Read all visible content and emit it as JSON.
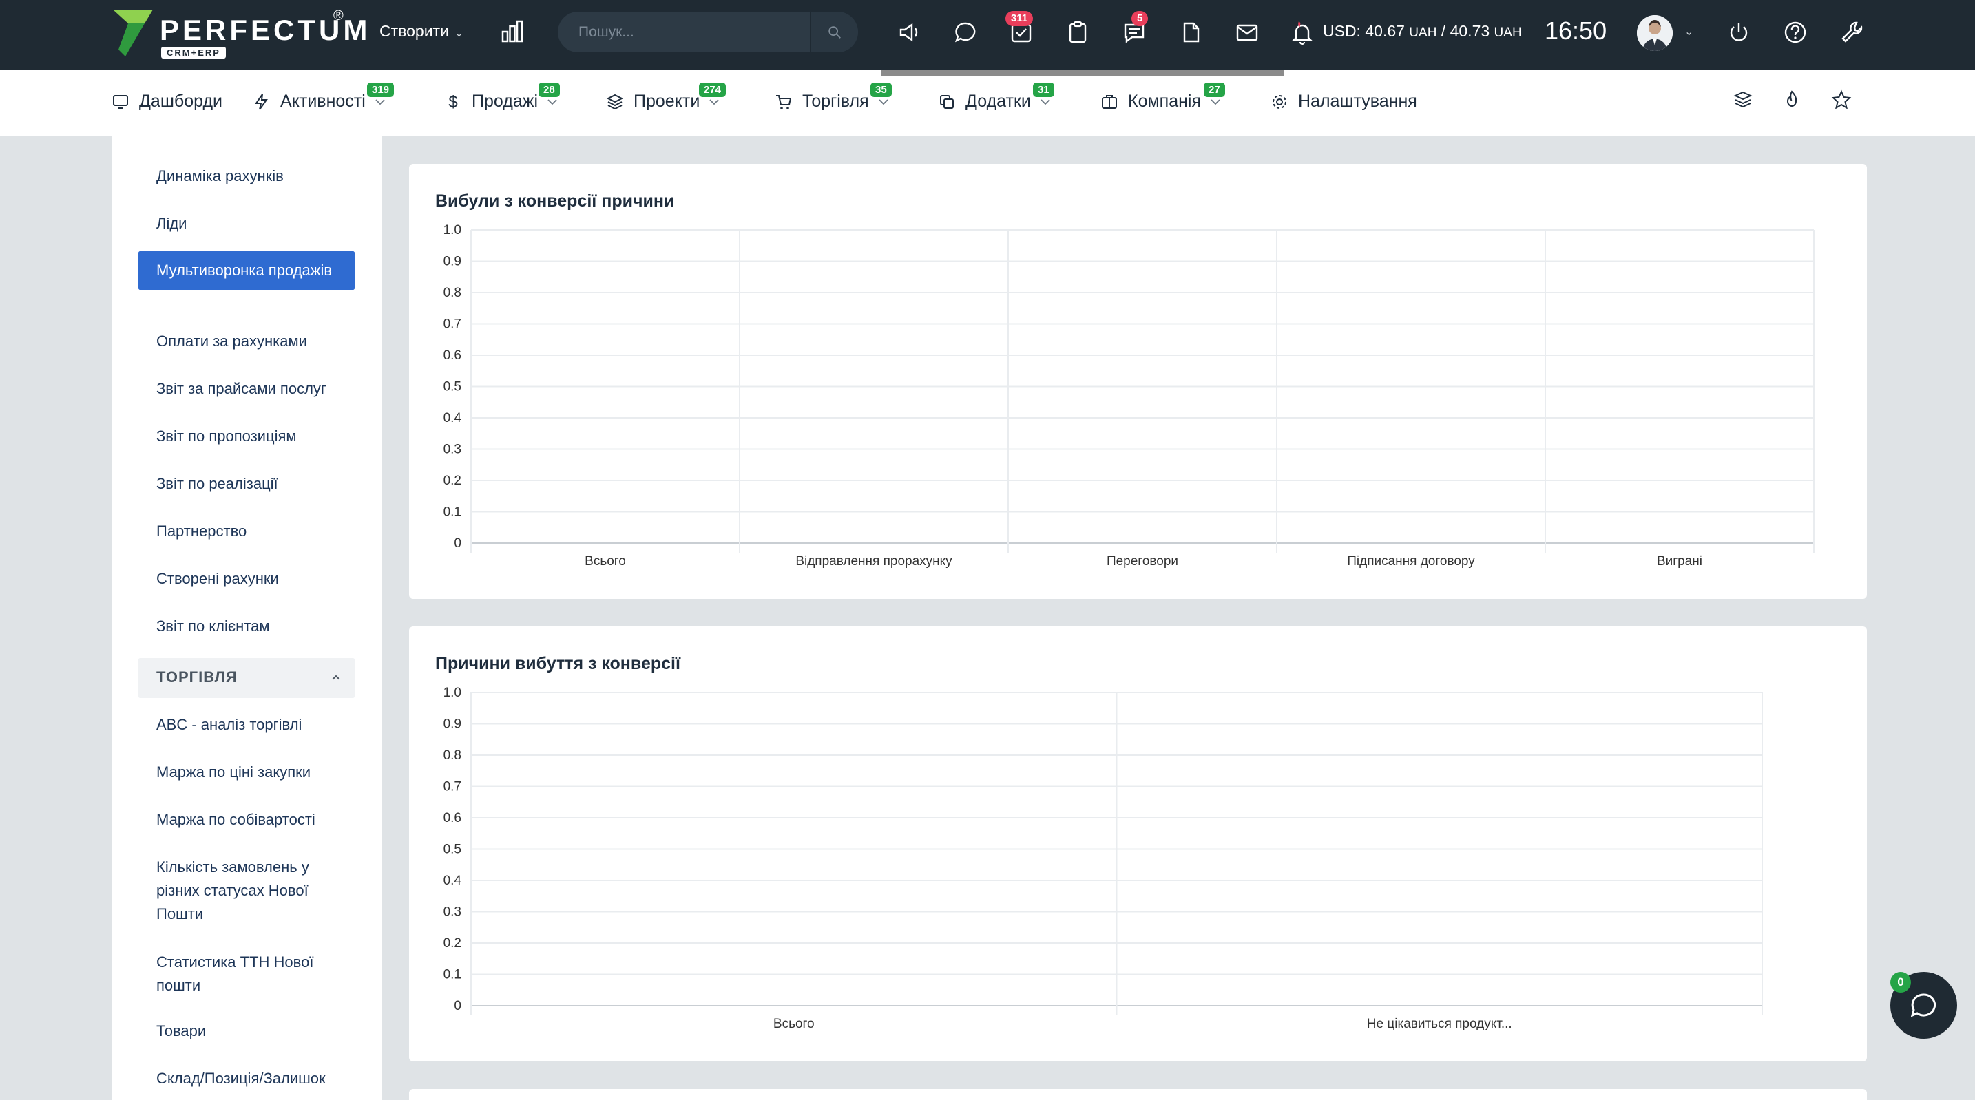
{
  "header": {
    "logo": {
      "brand": "PERFECTUM",
      "reg": "®",
      "sub": "CRM+ERP"
    },
    "create_label": "Створити",
    "search_placeholder": "Пошук...",
    "tasks_badge": "311",
    "messages_badge": "5",
    "currency": {
      "prefix": "USD: 40.67",
      "u1": "UAH",
      "sep": " / 40.73",
      "u2": "UAH"
    },
    "time": "16:50"
  },
  "nav": [
    {
      "label": "Дашборди",
      "badge": ""
    },
    {
      "label": "Активності",
      "badge": "319"
    },
    {
      "label": "Продажі",
      "badge": "28"
    },
    {
      "label": "Проекти",
      "badge": "274"
    },
    {
      "label": "Торгівля",
      "badge": "35"
    },
    {
      "label": "Додатки",
      "badge": "31"
    },
    {
      "label": "Компанія",
      "badge": "27"
    },
    {
      "label": "Налаштування",
      "badge": ""
    }
  ],
  "sidebar": {
    "items": [
      "Динаміка рахунків",
      "Ліди",
      "Мультиворонка продажів",
      "Оплати за рахунками",
      "Звіт за прайсами послуг",
      "Звіт по пропозиціям",
      "Звіт по реалізації",
      "Партнерство",
      "Створені рахунки",
      "Звіт по клієнтам"
    ],
    "group": "ТОРГІВЛЯ",
    "group_items": [
      "ABC - аналіз торгівлі",
      "Маржа по ціні закупки",
      "Маржа по собівартості",
      "Кількість замовлень у різних статусах Нової Пошти",
      "Статистика ТТН Нової пошти",
      "Товари",
      "Склад/Позиція/Залишок"
    ]
  },
  "chart_data": [
    {
      "type": "bar",
      "title": "Вибули з конверсії причини",
      "categories": [
        "Всього",
        "Відправлення прорахунку",
        "Переговори",
        "Підписання договору",
        "Виграні"
      ],
      "values": [
        0,
        0,
        0,
        0,
        0
      ],
      "yticks": [
        "0",
        "0.1",
        "0.2",
        "0.3",
        "0.4",
        "0.5",
        "0.6",
        "0.7",
        "0.8",
        "0.9",
        "1.0"
      ],
      "ylim": [
        0,
        1.0
      ],
      "grid": true
    },
    {
      "type": "bar",
      "title": "Причини вибуття з конверсії",
      "categories": [
        "Всього",
        "Не цікавиться продукт..."
      ],
      "values": [
        0,
        0
      ],
      "yticks": [
        "0",
        "0.1",
        "0.2",
        "0.3",
        "0.4",
        "0.5",
        "0.6",
        "0.7",
        "0.8",
        "0.9",
        "1.0"
      ],
      "ylim": [
        0,
        1.0
      ],
      "grid": true
    }
  ],
  "chat_badge": "0"
}
